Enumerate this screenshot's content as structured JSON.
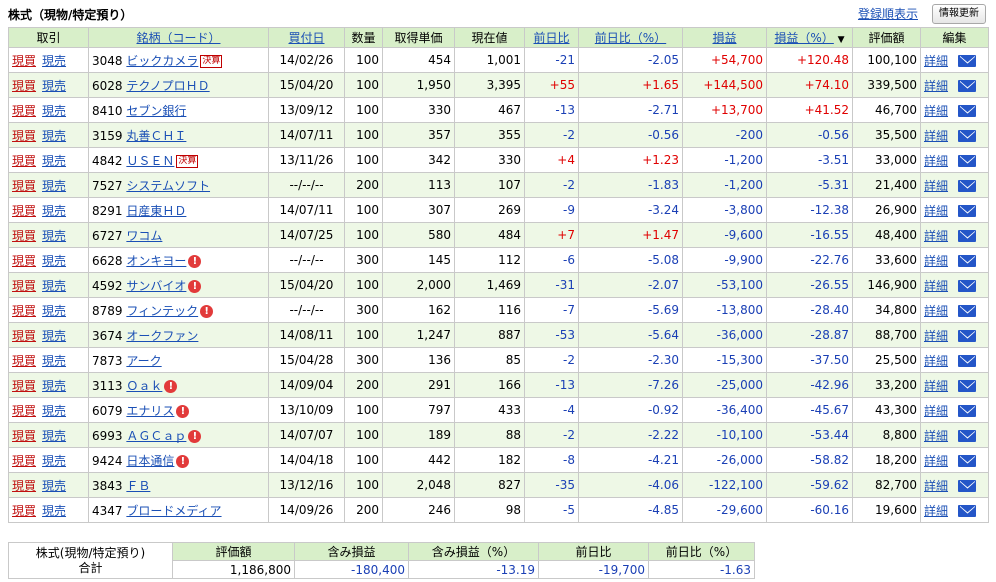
{
  "header": {
    "title": "株式（現物/特定預り）",
    "registered_order_link": "登録順表示",
    "refresh_button": "情報更新"
  },
  "columns": [
    "取引",
    "銘柄（コード）",
    "買付日",
    "数量",
    "取得単価",
    "現在値",
    "前日比",
    "前日比（%）",
    "損益",
    "損益（%）",
    "評価額",
    "編集"
  ],
  "sort_indicator": "▼",
  "trade_labels": {
    "buy": "現買",
    "sell": "現売"
  },
  "edit_label": "詳細",
  "rows": [
    {
      "code": "3048",
      "name": "ビックカメラ",
      "badge": "決算",
      "alert": false,
      "date": "14/02/26",
      "qty": "100",
      "cost": "454",
      "price": "1,001",
      "chg": "-21",
      "chg_pct": "-2.05",
      "pl": "+54,700",
      "pl_pct": "+120.48",
      "value": "100,100"
    },
    {
      "code": "6028",
      "name": "テクノプロＨＤ",
      "badge": "",
      "alert": false,
      "date": "15/04/20",
      "qty": "100",
      "cost": "1,950",
      "price": "3,395",
      "chg": "+55",
      "chg_pct": "+1.65",
      "pl": "+144,500",
      "pl_pct": "+74.10",
      "value": "339,500"
    },
    {
      "code": "8410",
      "name": "セブン銀行",
      "badge": "",
      "alert": false,
      "date": "13/09/12",
      "qty": "100",
      "cost": "330",
      "price": "467",
      "chg": "-13",
      "chg_pct": "-2.71",
      "pl": "+13,700",
      "pl_pct": "+41.52",
      "value": "46,700"
    },
    {
      "code": "3159",
      "name": "丸善ＣＨＩ",
      "badge": "",
      "alert": false,
      "date": "14/07/11",
      "qty": "100",
      "cost": "357",
      "price": "355",
      "chg": "-2",
      "chg_pct": "-0.56",
      "pl": "-200",
      "pl_pct": "-0.56",
      "value": "35,500"
    },
    {
      "code": "4842",
      "name": "ＵＳＥＮ",
      "badge": "決算",
      "alert": false,
      "date": "13/11/26",
      "qty": "100",
      "cost": "342",
      "price": "330",
      "chg": "+4",
      "chg_pct": "+1.23",
      "pl": "-1,200",
      "pl_pct": "-3.51",
      "value": "33,000"
    },
    {
      "code": "7527",
      "name": "システムソフト",
      "badge": "",
      "alert": false,
      "date": "--/--/--",
      "qty": "200",
      "cost": "113",
      "price": "107",
      "chg": "-2",
      "chg_pct": "-1.83",
      "pl": "-1,200",
      "pl_pct": "-5.31",
      "value": "21,400"
    },
    {
      "code": "8291",
      "name": "日産東ＨＤ",
      "badge": "",
      "alert": false,
      "date": "14/07/11",
      "qty": "100",
      "cost": "307",
      "price": "269",
      "chg": "-9",
      "chg_pct": "-3.24",
      "pl": "-3,800",
      "pl_pct": "-12.38",
      "value": "26,900"
    },
    {
      "code": "6727",
      "name": "ワコム",
      "badge": "",
      "alert": false,
      "date": "14/07/25",
      "qty": "100",
      "cost": "580",
      "price": "484",
      "chg": "+7",
      "chg_pct": "+1.47",
      "pl": "-9,600",
      "pl_pct": "-16.55",
      "value": "48,400"
    },
    {
      "code": "6628",
      "name": "オンキヨー",
      "badge": "",
      "alert": true,
      "date": "--/--/--",
      "qty": "300",
      "cost": "145",
      "price": "112",
      "chg": "-6",
      "chg_pct": "-5.08",
      "pl": "-9,900",
      "pl_pct": "-22.76",
      "value": "33,600"
    },
    {
      "code": "4592",
      "name": "サンバイオ",
      "badge": "",
      "alert": true,
      "date": "15/04/20",
      "qty": "100",
      "cost": "2,000",
      "price": "1,469",
      "chg": "-31",
      "chg_pct": "-2.07",
      "pl": "-53,100",
      "pl_pct": "-26.55",
      "value": "146,900"
    },
    {
      "code": "8789",
      "name": "フィンテック",
      "badge": "",
      "alert": true,
      "date": "--/--/--",
      "qty": "300",
      "cost": "162",
      "price": "116",
      "chg": "-7",
      "chg_pct": "-5.69",
      "pl": "-13,800",
      "pl_pct": "-28.40",
      "value": "34,800"
    },
    {
      "code": "3674",
      "name": "オークファン",
      "badge": "",
      "alert": false,
      "date": "14/08/11",
      "qty": "100",
      "cost": "1,247",
      "price": "887",
      "chg": "-53",
      "chg_pct": "-5.64",
      "pl": "-36,000",
      "pl_pct": "-28.87",
      "value": "88,700"
    },
    {
      "code": "7873",
      "name": "アーク",
      "badge": "",
      "alert": false,
      "date": "15/04/28",
      "qty": "300",
      "cost": "136",
      "price": "85",
      "chg": "-2",
      "chg_pct": "-2.30",
      "pl": "-15,300",
      "pl_pct": "-37.50",
      "value": "25,500"
    },
    {
      "code": "3113",
      "name": "Ｏａｋ",
      "badge": "",
      "alert": true,
      "date": "14/09/04",
      "qty": "200",
      "cost": "291",
      "price": "166",
      "chg": "-13",
      "chg_pct": "-7.26",
      "pl": "-25,000",
      "pl_pct": "-42.96",
      "value": "33,200"
    },
    {
      "code": "6079",
      "name": "エナリス",
      "badge": "",
      "alert": true,
      "date": "13/10/09",
      "qty": "100",
      "cost": "797",
      "price": "433",
      "chg": "-4",
      "chg_pct": "-0.92",
      "pl": "-36,400",
      "pl_pct": "-45.67",
      "value": "43,300"
    },
    {
      "code": "6993",
      "name": "ＡＧＣａｐ",
      "badge": "",
      "alert": true,
      "date": "14/07/07",
      "qty": "100",
      "cost": "189",
      "price": "88",
      "chg": "-2",
      "chg_pct": "-2.22",
      "pl": "-10,100",
      "pl_pct": "-53.44",
      "value": "8,800"
    },
    {
      "code": "9424",
      "name": "日本通信",
      "badge": "",
      "alert": true,
      "date": "14/04/18",
      "qty": "100",
      "cost": "442",
      "price": "182",
      "chg": "-8",
      "chg_pct": "-4.21",
      "pl": "-26,000",
      "pl_pct": "-58.82",
      "value": "18,200"
    },
    {
      "code": "3843",
      "name": "ＦＢ",
      "badge": "",
      "alert": false,
      "date": "13/12/16",
      "qty": "100",
      "cost": "2,048",
      "price": "827",
      "chg": "-35",
      "chg_pct": "-4.06",
      "pl": "-122,100",
      "pl_pct": "-59.62",
      "value": "82,700"
    },
    {
      "code": "4347",
      "name": "ブロードメディア",
      "badge": "",
      "alert": false,
      "date": "14/09/26",
      "qty": "200",
      "cost": "246",
      "price": "98",
      "chg": "-5",
      "chg_pct": "-4.85",
      "pl": "-29,600",
      "pl_pct": "-60.16",
      "value": "19,600"
    }
  ],
  "summary": {
    "label_line1": "株式(現物/特定預り)",
    "label_line2": "合計",
    "headers": [
      "評価額",
      "含み損益",
      "含み損益（%）",
      "前日比",
      "前日比（%）"
    ],
    "values": [
      "1,186,800",
      "-180,400",
      "-13.19",
      "-19,700",
      "-1.63"
    ]
  },
  "colors": {
    "header_bg": "#d8efc9",
    "stripe_bg": "#eef8e6",
    "positive": "#e00000",
    "negative": "#1a3fb5",
    "link": "#1a4fb5"
  }
}
